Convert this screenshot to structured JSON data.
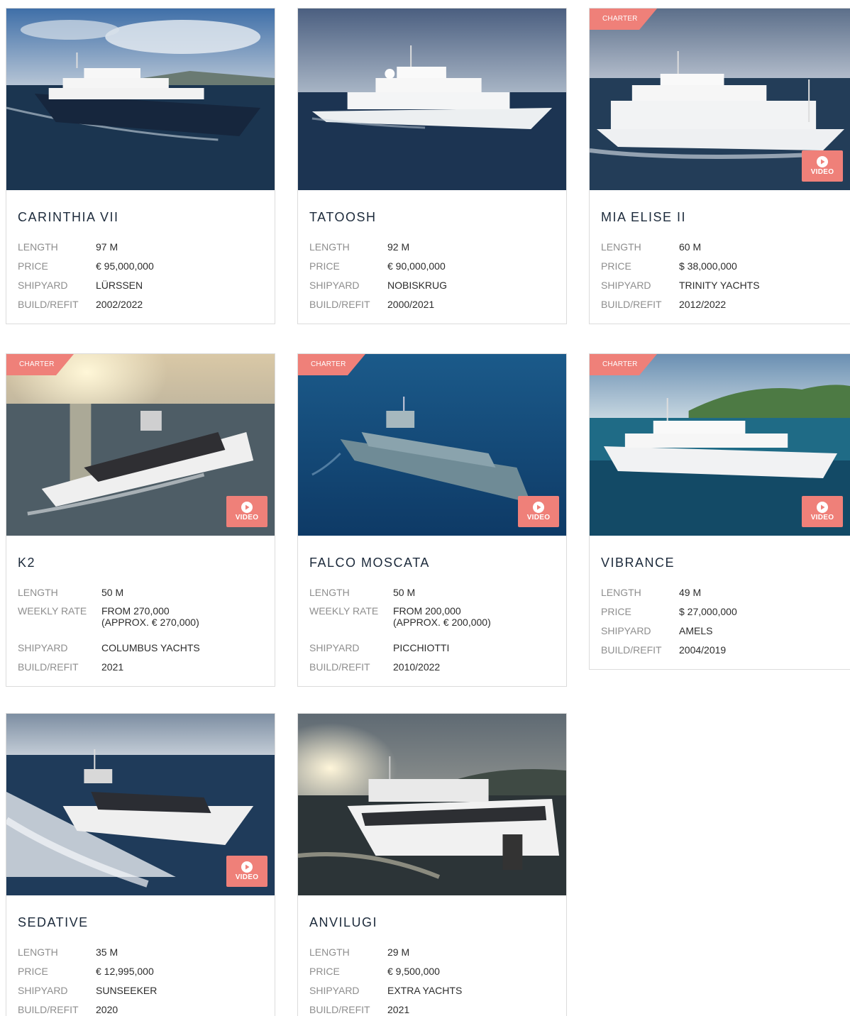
{
  "listing": {
    "charter_badge_label": "CHARTER",
    "video_button_label": "VIDEO",
    "cards": [
      {
        "name": "CARINTHIA VII",
        "charter": false,
        "video": false,
        "specs": [
          {
            "label": "LENGTH",
            "value": "97 M"
          },
          {
            "label": "PRICE",
            "value": "€ 95,000,000"
          },
          {
            "label": "SHIPYARD",
            "value": "LÜRSSEN"
          },
          {
            "label": "BUILD/REFIT",
            "value": "2002/2022"
          }
        ]
      },
      {
        "name": "TATOOSH",
        "charter": false,
        "video": false,
        "specs": [
          {
            "label": "LENGTH",
            "value": "92 M"
          },
          {
            "label": "PRICE",
            "value": "€ 90,000,000"
          },
          {
            "label": "SHIPYARD",
            "value": "NOBISKRUG"
          },
          {
            "label": "BUILD/REFIT",
            "value": "2000/2021"
          }
        ]
      },
      {
        "name": "MIA ELISE II",
        "charter": true,
        "video": true,
        "specs": [
          {
            "label": "LENGTH",
            "value": "60 M"
          },
          {
            "label": "PRICE",
            "value": "$ 38,000,000"
          },
          {
            "label": "SHIPYARD",
            "value": "TRINITY YACHTS"
          },
          {
            "label": "BUILD/REFIT",
            "value": "2012/2022"
          }
        ]
      },
      {
        "name": "K2",
        "charter": true,
        "video": true,
        "specs": [
          {
            "label": "LENGTH",
            "value": "50 M"
          },
          {
            "label": "WEEKLY RATE",
            "value": "FROM  270,000",
            "value2": "(APPROX. € 270,000)"
          },
          {
            "label": "SHIPYARD",
            "value": "COLUMBUS YACHTS"
          },
          {
            "label": "BUILD/REFIT",
            "value": "2021"
          }
        ]
      },
      {
        "name": "FALCO MOSCATA",
        "charter": true,
        "video": true,
        "specs": [
          {
            "label": "LENGTH",
            "value": "50 M"
          },
          {
            "label": "WEEKLY RATE",
            "value": "FROM  200,000",
            "value2": "(APPROX. € 200,000)"
          },
          {
            "label": "SHIPYARD",
            "value": "PICCHIOTTI"
          },
          {
            "label": "BUILD/REFIT",
            "value": "2010/2022"
          }
        ]
      },
      {
        "name": "VIBRANCE",
        "charter": true,
        "video": true,
        "specs": [
          {
            "label": "LENGTH",
            "value": "49 M"
          },
          {
            "label": "PRICE",
            "value": "$ 27,000,000"
          },
          {
            "label": "SHIPYARD",
            "value": "AMELS"
          },
          {
            "label": "BUILD/REFIT",
            "value": "2004/2019"
          }
        ]
      },
      {
        "name": "SEDATIVE",
        "charter": false,
        "video": true,
        "specs": [
          {
            "label": "LENGTH",
            "value": "35 M"
          },
          {
            "label": "PRICE",
            "value": "€ 12,995,000"
          },
          {
            "label": "SHIPYARD",
            "value": "SUNSEEKER"
          },
          {
            "label": "BUILD/REFIT",
            "value": "2020"
          }
        ]
      },
      {
        "name": "ANVILUGI",
        "charter": false,
        "video": false,
        "specs": [
          {
            "label": "LENGTH",
            "value": "29 M"
          },
          {
            "label": "PRICE",
            "value": "€ 9,500,000"
          },
          {
            "label": "SHIPYARD",
            "value": "EXTRA YACHTS"
          },
          {
            "label": "BUILD/REFIT",
            "value": "2021"
          }
        ]
      }
    ]
  },
  "colors": {
    "accent": "#ef8079",
    "title": "#1c2a3b",
    "label": "#8e8e8e",
    "value": "#2c2c2c",
    "border": "#dcdcdc"
  }
}
